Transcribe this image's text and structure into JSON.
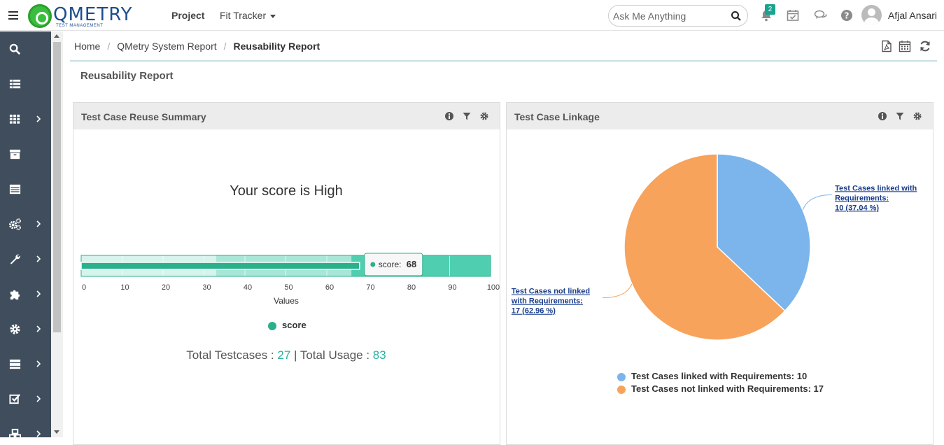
{
  "header": {
    "logo_text": "QMETRY",
    "logo_sub": "TEST MANAGEMENT",
    "nav_project": "Project",
    "nav_fit_tracker": "Fit Tracker",
    "search_placeholder": "Ask Me Anything",
    "notifications_count": "2",
    "user_name": "Afjal Ansari"
  },
  "sidebar": {
    "items": [
      {
        "icon": "search-icon",
        "has_submenu": false
      },
      {
        "icon": "list-icon",
        "has_submenu": false
      },
      {
        "icon": "grid-icon",
        "has_submenu": true
      },
      {
        "icon": "archive-icon",
        "has_submenu": false
      },
      {
        "icon": "table-icon",
        "has_submenu": false
      },
      {
        "icon": "cogs-icon",
        "has_submenu": true
      },
      {
        "icon": "wrench-icon",
        "has_submenu": true
      },
      {
        "icon": "puzzle-icon",
        "has_submenu": true
      },
      {
        "icon": "gear-icon",
        "has_submenu": true
      },
      {
        "icon": "server-icon",
        "has_submenu": true
      },
      {
        "icon": "checkbox-icon",
        "has_submenu": true
      },
      {
        "icon": "cubes-icon",
        "has_submenu": true
      }
    ]
  },
  "breadcrumb": {
    "home": "Home",
    "system_report": "QMetry System Report",
    "current": "Reusability Report"
  },
  "page_title": "Reusability Report",
  "reuse_panel": {
    "title": "Test Case Reuse Summary",
    "score_text": "Your score is High",
    "totals_label_1": "Total Testcases : ",
    "total_testcases": "27",
    "totals_sep": " | Total Usage : ",
    "total_usage": "83"
  },
  "linkage_panel": {
    "title": "Test Case Linkage"
  },
  "chart_data": [
    {
      "type": "bar",
      "subtype": "bullet-gauge",
      "xlabel": "Values",
      "xlim": [
        0,
        100
      ],
      "ticks": [
        0,
        10,
        20,
        30,
        40,
        50,
        60,
        70,
        80,
        90,
        100
      ],
      "bands": [
        [
          0,
          33
        ],
        [
          33,
          66
        ],
        [
          66,
          100
        ]
      ],
      "series": [
        {
          "name": "score",
          "values": [
            68
          ]
        }
      ],
      "tooltip": {
        "label": "score",
        "value": 68
      },
      "colors": {
        "bar": "#2ab08a",
        "band_fill": "#4fcfb0"
      }
    },
    {
      "type": "pie",
      "slices": [
        {
          "label": "Test Cases linked with Requirements",
          "value": 10,
          "percent": "37.04",
          "color": "#7cb5ec"
        },
        {
          "label": "Test Cases not linked with Requirements",
          "value": 17,
          "percent": "62.96",
          "color": "#f7a35c"
        }
      ],
      "data_labels": [
        [
          "Test Cases linked with",
          "Requirements:",
          "10 (37.04 %)"
        ],
        [
          "Test Cases not linked",
          "with Requirements:",
          "17 (62.96 %)"
        ]
      ],
      "legend": [
        "Test Cases linked with Requirements: 10",
        "Test Cases not linked with Requirements: 17"
      ]
    }
  ]
}
